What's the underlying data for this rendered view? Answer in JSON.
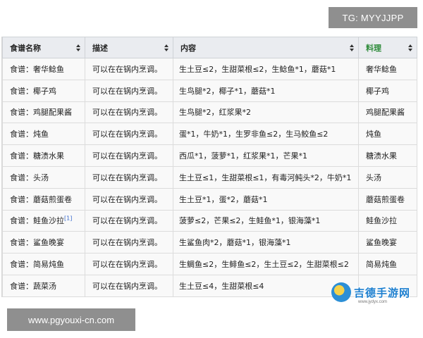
{
  "watermark": {
    "tg": "TG: MYYJJPP",
    "url": "www.pgyouxi-cn.com",
    "logo_text": "吉德手游网",
    "logo_sub": "www.jydyx.com"
  },
  "table": {
    "headers": {
      "name": "食谱名称",
      "desc": "描述",
      "content": "内容",
      "dish": "料理"
    },
    "accent_color": "#2e8b3a",
    "rows": [
      {
        "name": "食谱：奢华鲶鱼",
        "desc": "可以在在锅内烹调。",
        "content": "生土豆≤2，生甜菜根≤2，生鲶鱼*1，蘑菇*1",
        "dish": "奢华鲶鱼"
      },
      {
        "name": "食谱：椰子鸡",
        "desc": "可以在在锅内烹调。",
        "content": "生鸟腿*2，椰子*1，蘑菇*1",
        "dish": "椰子鸡"
      },
      {
        "name": "食谱：鸡腿配果酱",
        "desc": "可以在在锅内烹调。",
        "content": "生鸟腿*2，红浆果*2",
        "dish": "鸡腿配果酱"
      },
      {
        "name": "食谱：炖鱼",
        "desc": "可以在在锅内烹调。",
        "content": "蛋*1，牛奶*1，生罗非鱼≤2，生马鲛鱼≤2",
        "dish": "炖鱼"
      },
      {
        "name": "食谱：糖渍水果",
        "desc": "可以在在锅内烹调。",
        "content": "西瓜*1，菠萝*1，红浆果*1，芒果*1",
        "dish": "糖渍水果"
      },
      {
        "name": "食谱：头汤",
        "desc": "可以在在锅内烹调。",
        "content": "生土豆≤1，生甜菜根≤1，有毒河鲀头*2，牛奶*1",
        "dish": "头汤"
      },
      {
        "name": "食谱：蘑菇煎蛋卷",
        "desc": "可以在在锅内烹调。",
        "content": "生土豆*1，蛋*2，蘑菇*1",
        "dish": "蘑菇煎蛋卷"
      },
      {
        "name": "食谱：鲑鱼沙拉",
        "ref": "[1]",
        "desc": "可以在在锅内烹调。",
        "content": "菠萝≤2，芒果≤2，生鲑鱼*1，银海藻*1",
        "dish": "鲑鱼沙拉"
      },
      {
        "name": "食谱：鲨鱼晚宴",
        "desc": "可以在在锅内烹调。",
        "content": "生鲨鱼肉*2，蘑菇*1，银海藻*1",
        "dish": "鲨鱼晚宴"
      },
      {
        "name": "食谱：简易炖鱼",
        "desc": "可以在在锅内烹调。",
        "content": "生鲷鱼≤2，生鲱鱼≤2，生土豆≤2，生甜菜根≤2",
        "dish": "简易炖鱼"
      },
      {
        "name": "食谱：蔬菜汤",
        "desc": "可以在在锅内烹调。",
        "content": "生土豆≤4，生甜菜根≤4",
        "dish": ""
      }
    ]
  }
}
